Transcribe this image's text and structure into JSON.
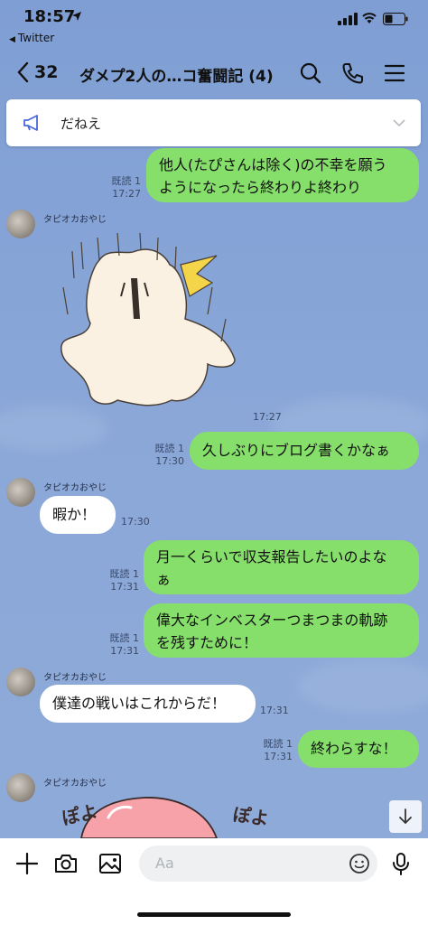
{
  "status_bar": {
    "time": "18:57",
    "back_app": "Twitter"
  },
  "header": {
    "back_count": "32",
    "title": "ダメプ2人の…コ奮闘記 (4)"
  },
  "announcement": {
    "text": "だねえ"
  },
  "messages": [
    {
      "from": "me",
      "text_lines": [
        "他人(たぴさんは除く)の不幸を願う",
        "ようになったら終わりよ終わり"
      ],
      "read": "既読 1",
      "time": "17:27"
    },
    {
      "from": "other",
      "sender": "タピオカおやじ",
      "type": "sticker",
      "time": "17:27"
    },
    {
      "from": "me",
      "text_lines": [
        "久しぶりにブログ書くかなぁ"
      ],
      "read": "既読 1",
      "time": "17:30"
    },
    {
      "from": "other",
      "sender": "タピオカおやじ",
      "text_lines": [
        "暇か！"
      ],
      "time": "17:30"
    },
    {
      "from": "me",
      "text_lines": [
        "月一くらいで収支報告したいのよな",
        "ぁ"
      ],
      "read": "既読 1",
      "time": "17:31"
    },
    {
      "from": "me",
      "text_lines": [
        "偉大なインベスターつまつまの軌跡",
        "を残すために！"
      ],
      "read": "既読 1",
      "time": "17:31"
    },
    {
      "from": "other",
      "sender": "タピオカおやじ",
      "text_lines": [
        "僕達の戦いはこれからだ！"
      ],
      "time": "17:31"
    },
    {
      "from": "me",
      "text_lines": [
        "終わらすな！"
      ],
      "read": "既読 1",
      "time": "17:31"
    },
    {
      "from": "other",
      "sender": "タピオカおやじ",
      "type": "sticker",
      "sticker_text": [
        "ぽよ",
        "ぽよ"
      ]
    }
  ],
  "input": {
    "placeholder": "Aa"
  },
  "colors": {
    "my_bubble": "#86df6b",
    "other_bubble": "#ffffff",
    "background": "#8aa7d8"
  }
}
